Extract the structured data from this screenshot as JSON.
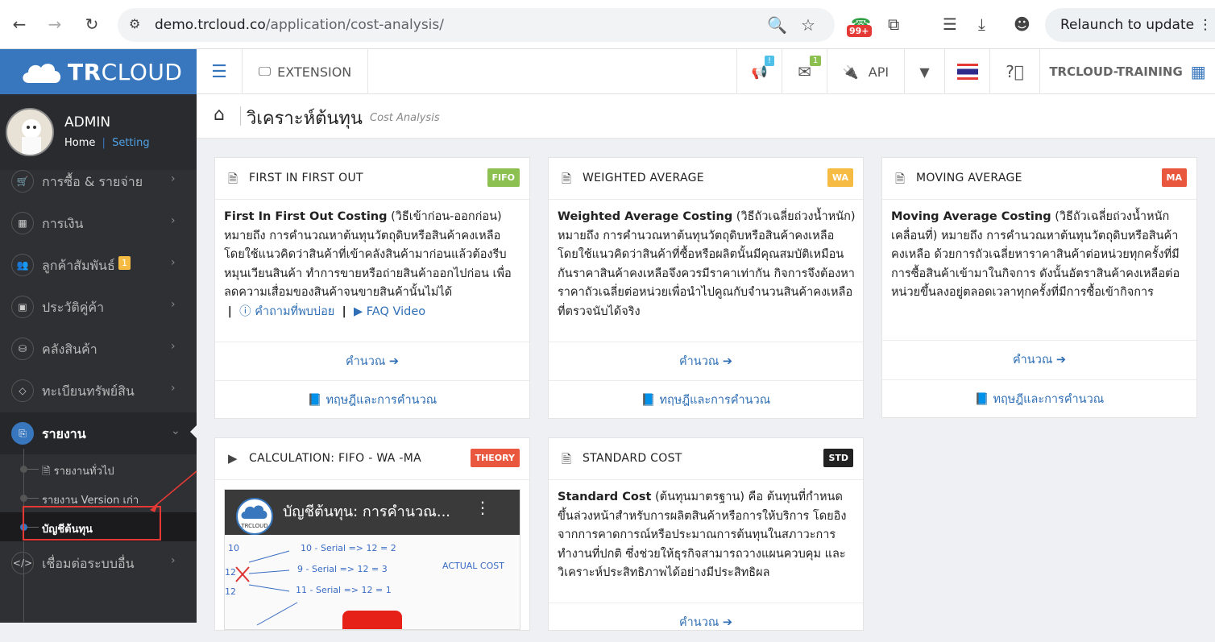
{
  "browser": {
    "url_host": "demo.trcloud.co",
    "url_path": "/application/cost-analysis/",
    "ext_badge": "99+",
    "relaunch_label": "Relaunch to update"
  },
  "brand": {
    "name_bold": "TR",
    "name_light": "CLOUD"
  },
  "topbar": {
    "extension_label": "EXTENSION",
    "announce_badge": "!",
    "mail_badge": "1",
    "api_label": "API",
    "company": "TRCLOUD-TRAINING"
  },
  "user": {
    "name": "ADMIN",
    "home": "Home",
    "sep": "|",
    "setting": "Setting"
  },
  "sidebar": {
    "items": [
      {
        "label": "การซื้อ & รายจ่าย",
        "icon": "cart-icon"
      },
      {
        "label": "การเงิน",
        "icon": "calendar-icon"
      },
      {
        "label": "ลูกค้าสัมพันธ์",
        "icon": "users-icon",
        "badge": "1"
      },
      {
        "label": "ประวัติคู่ค้า",
        "icon": "contact-icon"
      },
      {
        "label": "คลังสินค้า",
        "icon": "boxes-icon"
      },
      {
        "label": "ทะเบียนทรัพย์สิน",
        "icon": "diamond-icon"
      },
      {
        "label": "รายงาน",
        "icon": "report-icon"
      },
      {
        "label": "เชื่อมต่อระบบอื่น",
        "icon": "code-icon"
      }
    ],
    "sub_items": [
      {
        "label": "รายงานทั่วไป"
      },
      {
        "label": "รายงาน Version เก่า"
      },
      {
        "label": "บัญชีต้นทุน"
      }
    ]
  },
  "page": {
    "title": "วิเคราะห์ต้นทุน",
    "subtitle": "Cost Analysis"
  },
  "cards": {
    "fifo": {
      "title": "FIRST IN FIRST OUT",
      "tag": "FIFO",
      "bold": "First In First Out Costing",
      "text": " (วิธีเข้าก่อน-ออกก่อน) หมายถึง การคำนวณหาต้นทุนวัตถุดิบหรือสินค้าคงเหลือ โดยใช้แนวคิดว่าสินค้าที่เข้าคลังสินค้ามาก่อนแล้วต้องรีบหมุนเวียนสินค้า ทำการขายหรือถ่ายสินค้าออกไปก่อน เพื่อลดความเสื่อมของสินค้าจนขายสินค้านั้นไม่ได้",
      "faq_label": "คำถามที่พบบ่อย",
      "video_label": "FAQ Video",
      "calc_label": "คำนวณ",
      "theory_label": "ทฤษฎีและการคำนวณ"
    },
    "wa": {
      "title": "WEIGHTED AVERAGE",
      "tag": "WA",
      "bold": "Weighted Average Costing",
      "text": " (วิธีถัวเฉลี่ยถ่วงน้ำหนัก) หมายถึง การคำนวณหาต้นทุนวัตถุดิบหรือสินค้าคงเหลือ โดยใช้แนวคิดว่าสินค้าที่ซื้อหรือผลิตนั้นมีคุณสมบัติเหมือนกันราคาสินค้าคงเหลือจึงควรมีราคาเท่ากัน กิจการจึงต้องหาราคาถัวเฉลี่ยต่อหน่วยเพื่อนำไปคูณกับจำนวนสินค้าคงเหลือที่ตรวจนับได้จริง",
      "calc_label": "คำนวณ",
      "theory_label": "ทฤษฎีและการคำนวณ"
    },
    "ma": {
      "title": "MOVING AVERAGE",
      "tag": "MA",
      "bold": "Moving Average Costing",
      "text": " (วิธีถัวเฉลี่ยถ่วงน้ำหนักเคลื่อนที่) หมายถึง การคำนวณหาต้นทุนวัตถุดิบหรือสินค้าคงเหลือ ด้วยการถัวเฉลี่ยหาราคาสินค้าต่อหน่วยทุกครั้งที่มีการซื้อสินค้าเข้ามาในกิจการ ดังนั้นอัตราสินค้าคงเหลือต่อหน่วยขึ้นลงอยู่ตลอดเวลาทุกครั้งที่มีการซื้อเข้ากิจการ",
      "calc_label": "คำนวณ",
      "theory_label": "ทฤษฎีและการคำนวณ"
    },
    "calc": {
      "title": "CALCULATION: FIFO - WA -MA",
      "tag": "THEORY",
      "video_title": "บัญชีต้นทุน: การคำนวณ...",
      "logo_text": "TRCLOUD",
      "hw1": "10 - Serial  => 12    = 2",
      "hw2": "9 - Serial  => 12    = 3",
      "hw3": "11 - Serial  => 12    = 1",
      "hw4": "ACTUAL COST",
      "hw5": "10",
      "hw6": "12",
      "hw7": "12"
    },
    "std": {
      "title": "STANDARD COST",
      "tag": "STD",
      "bold": "Standard Cost",
      "text": " (ต้นทุนมาตรฐาน) คือ ต้นทุนที่กำหนดขึ้นล่วงหน้าสำหรับการผลิตสินค้าหรือการให้บริการ โดยอิงจากการคาดการณ์หรือประมาณการต้นทุนในสภาวะการทำงานที่ปกติ ซึ่งช่วยให้ธุรกิจสามารถวางแผนควบคุม และวิเคราะห์ประสิทธิภาพได้อย่างมีประสิทธิผล",
      "calc_label": "คำนวณ"
    }
  },
  "colors": {
    "fifo": "#8cc152",
    "wa": "#f6bb42",
    "ma": "#e9573f",
    "theory": "#e9573f",
    "std": "#222222",
    "brand": "#3877bd"
  }
}
